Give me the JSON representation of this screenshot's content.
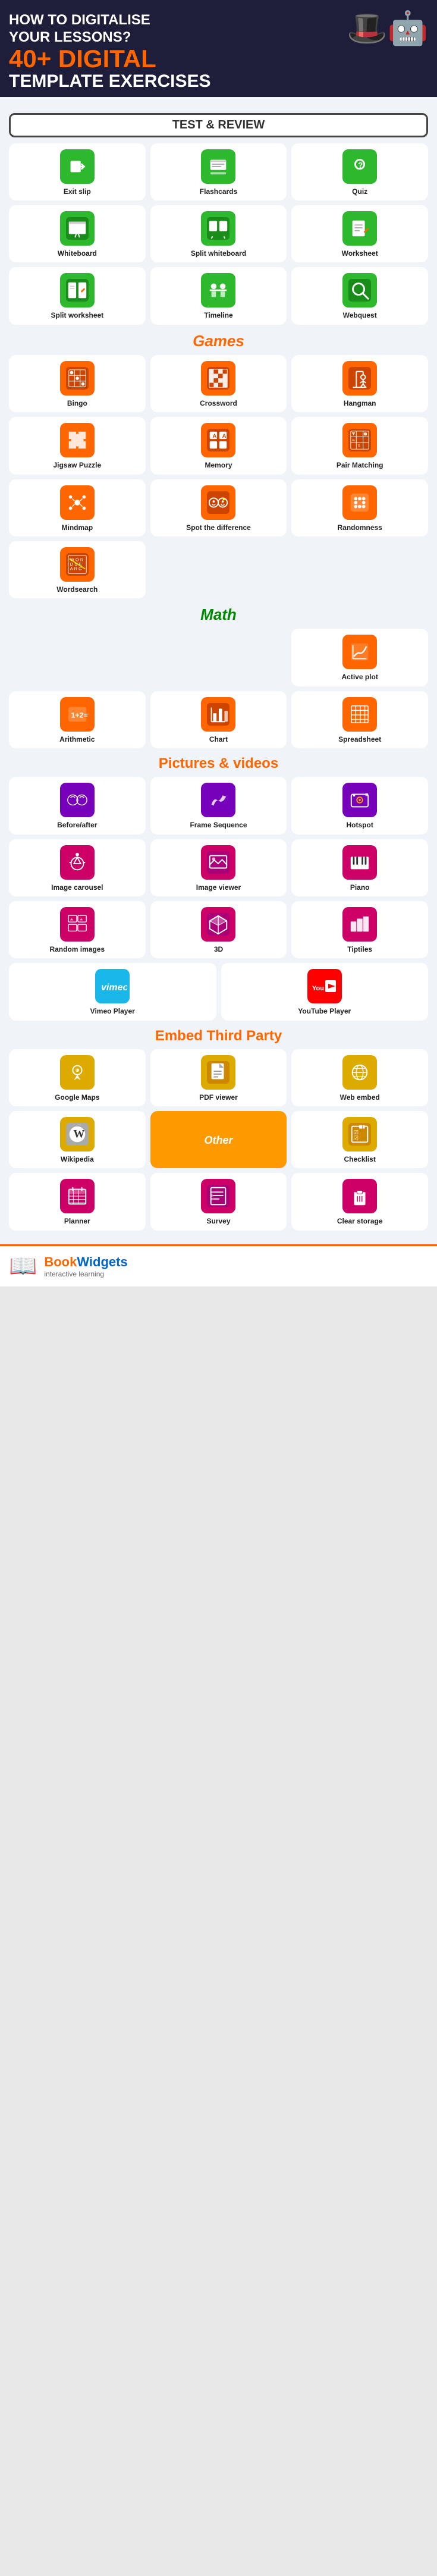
{
  "header": {
    "line1": "HOW TO DIGITALISE",
    "line2": "YOUR LESSONS?",
    "line3": "40+ DIGITAL",
    "line4": "TEMPLATE EXERCISES",
    "char": "🤖"
  },
  "sections": {
    "test_review": {
      "label": "TEST & REVIEW",
      "items": [
        {
          "id": "exit-slip",
          "label": "Exit slip",
          "icon": "🚪",
          "color": "green"
        },
        {
          "id": "flashcards",
          "label": "Flashcards",
          "icon": "📋",
          "color": "green"
        },
        {
          "id": "quiz",
          "label": "Quiz",
          "icon": "❓",
          "color": "green"
        },
        {
          "id": "whiteboard",
          "label": "Whiteboard",
          "icon": "📌",
          "color": "green"
        },
        {
          "id": "split-whiteboard",
          "label": "Split whiteboard",
          "icon": "⊞",
          "color": "green"
        },
        {
          "id": "worksheet",
          "label": "Worksheet",
          "icon": "📝",
          "color": "green"
        },
        {
          "id": "split-worksheet",
          "label": "Split worksheet",
          "icon": "🗂",
          "color": "green"
        },
        {
          "id": "timeline",
          "label": "Timeline",
          "icon": "⏱",
          "color": "green"
        },
        {
          "id": "webquest",
          "label": "Webquest",
          "icon": "🔍",
          "color": "green"
        }
      ]
    },
    "games": {
      "label": "Games",
      "items": [
        {
          "id": "bingo",
          "label": "Bingo",
          "icon": "🎯",
          "color": "orange"
        },
        {
          "id": "crossword",
          "label": "Crossword",
          "icon": "#",
          "color": "orange"
        },
        {
          "id": "hangman",
          "label": "Hangman",
          "icon": "🪝",
          "color": "orange"
        },
        {
          "id": "jigsaw",
          "label": "Jigsaw Puzzle",
          "icon": "🧩",
          "color": "orange"
        },
        {
          "id": "memory",
          "label": "Memory",
          "icon": "🟦",
          "color": "orange"
        },
        {
          "id": "pair-matching",
          "label": "Pair Matching",
          "icon": "🃏",
          "color": "orange"
        },
        {
          "id": "mindmap",
          "label": "Mindmap",
          "icon": "🗺",
          "color": "orange"
        },
        {
          "id": "spot-difference",
          "label": "Spot the difference",
          "icon": "👁",
          "color": "orange"
        },
        {
          "id": "randomness",
          "label": "Randomness",
          "icon": "🎲",
          "color": "orange"
        },
        {
          "id": "wordsearch",
          "label": "Wordsearch",
          "icon": "🔤",
          "color": "orange"
        }
      ]
    },
    "math": {
      "label": "Math",
      "items": [
        {
          "id": "active-plot",
          "label": "Active plot",
          "icon": "📈",
          "color": "orange"
        },
        {
          "id": "arithmetic",
          "label": "Arithmetic",
          "icon": "➕",
          "color": "orange"
        },
        {
          "id": "chart",
          "label": "Chart",
          "icon": "📊",
          "color": "orange"
        },
        {
          "id": "spreadsheet",
          "label": "Spreadsheet",
          "icon": "📅",
          "color": "orange"
        }
      ]
    },
    "pictures": {
      "label": "Pictures & videos",
      "items": [
        {
          "id": "before-after",
          "label": "Before/after",
          "icon": "🖼",
          "color": "purple"
        },
        {
          "id": "frame-sequence",
          "label": "Frame Sequence",
          "icon": "🐦",
          "color": "purple"
        },
        {
          "id": "hotspot",
          "label": "Hotspot",
          "icon": "📷",
          "color": "purple"
        },
        {
          "id": "image-carousel",
          "label": "Image carousel",
          "icon": "🔄",
          "color": "purple"
        },
        {
          "id": "image-viewer",
          "label": "Image viewer",
          "icon": "🏔",
          "color": "purple"
        },
        {
          "id": "piano",
          "label": "Piano",
          "icon": "🎹",
          "color": "purple"
        },
        {
          "id": "random-images",
          "label": "Random images",
          "icon": "🖼",
          "color": "purple"
        },
        {
          "id": "3d",
          "label": "3D",
          "icon": "△",
          "color": "purple"
        },
        {
          "id": "tiptiles",
          "label": "Tiptiles",
          "icon": "🏙",
          "color": "purple"
        },
        {
          "id": "vimeo",
          "label": "Vimeo Player",
          "icon": "▶",
          "color": "purple"
        },
        {
          "id": "youtube",
          "label": "YouTube Player",
          "icon": "▶",
          "color": "red"
        }
      ]
    },
    "embed": {
      "label": "Embed Third Party",
      "items": [
        {
          "id": "google-maps",
          "label": "Google Maps",
          "icon": "📍",
          "color": "yellow"
        },
        {
          "id": "pdf-viewer",
          "label": "PDF viewer",
          "icon": "📄",
          "color": "yellow"
        },
        {
          "id": "web-embed",
          "label": "Web embed",
          "icon": "🌐",
          "color": "yellow"
        },
        {
          "id": "wikipedia",
          "label": "Wikipedia",
          "icon": "W",
          "color": "yellow"
        }
      ]
    },
    "other": {
      "label": "Other",
      "items": [
        {
          "id": "checklist",
          "label": "Checklist",
          "icon": "☑",
          "color": "yellow"
        },
        {
          "id": "planner",
          "label": "Planner",
          "icon": "📅",
          "color": "pink"
        },
        {
          "id": "survey",
          "label": "Survey",
          "icon": "📋",
          "color": "pink"
        },
        {
          "id": "clear-storage",
          "label": "Clear storage",
          "icon": "🗑",
          "color": "pink"
        }
      ]
    }
  },
  "footer": {
    "logo": "📖",
    "brand1": "Book",
    "brand2": "Widgets",
    "tagline": "interactive learning"
  }
}
